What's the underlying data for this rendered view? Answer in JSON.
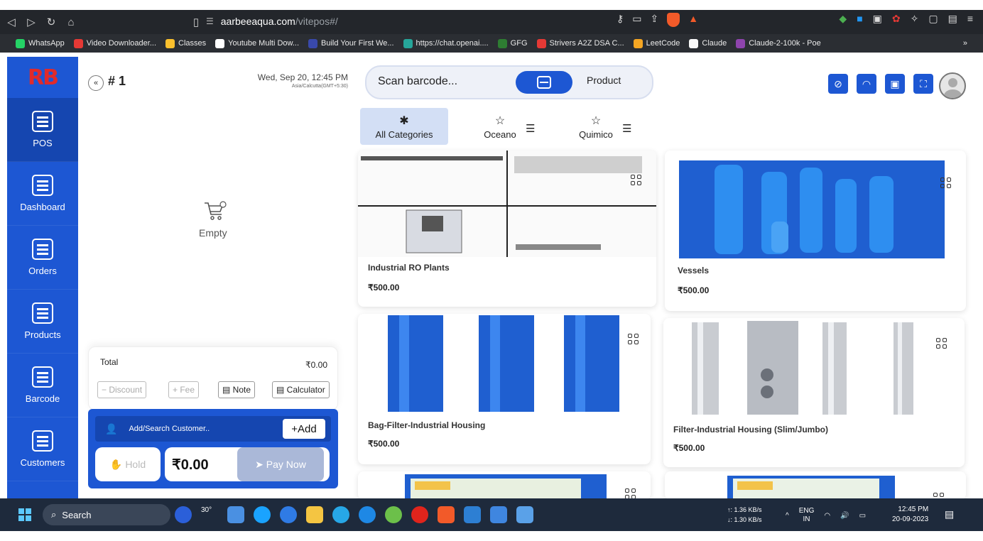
{
  "browser": {
    "url_domain": "aarbeeaqua.com",
    "url_path": "/vitepos#/",
    "bookmarks": [
      {
        "label": "WhatsApp",
        "color": "#25d366"
      },
      {
        "label": "Video Downloader...",
        "color": "#e53935"
      },
      {
        "label": "Classes",
        "color": "#fbc02d"
      },
      {
        "label": "Youtube Multi Dow...",
        "color": "#ffffff"
      },
      {
        "label": "Build Your First We...",
        "color": "#3949ab"
      },
      {
        "label": "https://chat.openai....",
        "color": "#26a69a"
      },
      {
        "label": "GFG",
        "color": "#2e7d32"
      },
      {
        "label": "Strivers A2Z DSA C...",
        "color": "#e53935"
      },
      {
        "label": "LeetCode",
        "color": "#f5a623"
      },
      {
        "label": "Claude",
        "color": "#fafafa"
      },
      {
        "label": "Claude-2-100k - Poe",
        "color": "#8e44ad"
      }
    ]
  },
  "sidebar": {
    "logo": "RB",
    "items": [
      {
        "label": "POS",
        "icon": "pos-icon"
      },
      {
        "label": "Dashboard",
        "icon": "dashboard-icon"
      },
      {
        "label": "Orders",
        "icon": "orders-icon"
      },
      {
        "label": "Products",
        "icon": "products-icon"
      },
      {
        "label": "Barcode",
        "icon": "barcode-icon"
      },
      {
        "label": "Customers",
        "icon": "customers-icon"
      }
    ]
  },
  "order": {
    "number": "# 1",
    "date": "Wed, Sep 20, 12:45 PM",
    "timezone": "Asia/Calcutta(GMT+5:30)",
    "empty_label": "Empty",
    "total_label": "Total",
    "total_value": "₹0.00",
    "discount_label": "Discount",
    "fee_label": "Fee",
    "note_label": "Note",
    "calculator_label": "Calculator",
    "customer_label": "Add/Search Customer..",
    "add_label": "Add",
    "hold_label": "Hold",
    "amount": "₹0.00",
    "pay_label": "Pay Now"
  },
  "header": {
    "scan_placeholder": "Scan barcode...",
    "product_tab": "Product"
  },
  "categories": [
    {
      "label": "All Categories"
    },
    {
      "label": "Oceano"
    },
    {
      "label": "Quimico"
    }
  ],
  "products": [
    {
      "name": "Industrial RO Plants",
      "price": "₹500.00"
    },
    {
      "name": "Vessels",
      "price": "₹500.00"
    },
    {
      "name": "Bag-Filter-Industrial Housing",
      "price": "₹500.00"
    },
    {
      "name": "Filter-Industrial Housing (Slim/Jumbo)",
      "price": "₹500.00"
    },
    {
      "name": "",
      "price": ""
    },
    {
      "name": "",
      "price": ""
    }
  ],
  "taskbar": {
    "search_label": "Search",
    "weather": "30°",
    "net_up": "↑: 1.36 KB/s",
    "net_down": "↓: 1.30 KB/s",
    "lang": "ENG",
    "region": "IN",
    "time": "12:45 PM",
    "date": "20-09-2023"
  },
  "colors": {
    "primary": "#1d57d3",
    "primary_dark": "#1546b0",
    "logo": "#e12a2a",
    "category_active": "#d3dff5"
  }
}
